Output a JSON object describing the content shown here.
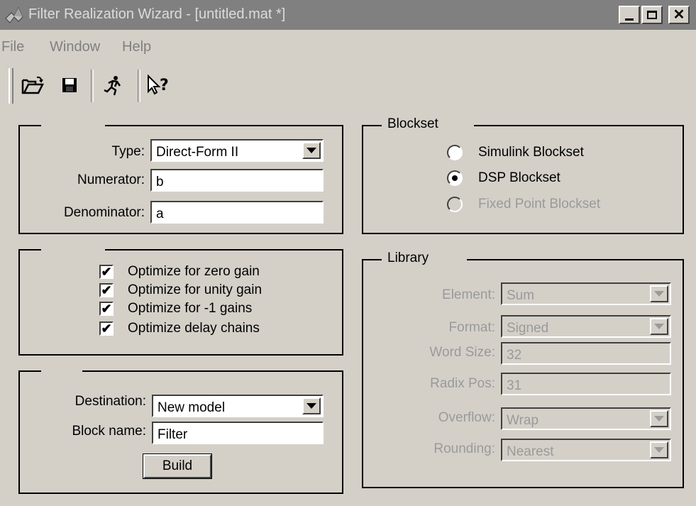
{
  "window": {
    "title": "Filter Realization Wizard - [untitled.mat *]",
    "min_label": "_",
    "max_label": "□",
    "close_label": "✕"
  },
  "menu": [
    "File",
    "Window",
    "Help"
  ],
  "toolbar": [
    "open-icon",
    "save-icon",
    "run-icon",
    "whats-this-icon"
  ],
  "structure": {
    "type_label": "Type:",
    "type_value": "Direct-Form II",
    "numerator_label": "Numerator:",
    "numerator_value": "b",
    "denominator_label": "Denominator:",
    "denominator_value": "a"
  },
  "optimization": {
    "items": [
      {
        "label": "Optimize for zero gain",
        "checked": true
      },
      {
        "label": "Optimize for unity gain",
        "checked": true
      },
      {
        "label": "Optimize for -1 gains",
        "checked": true
      },
      {
        "label": "Optimize delay chains",
        "checked": true
      }
    ]
  },
  "destination": {
    "destination_label": "Destination:",
    "destination_value": "New model",
    "block_name_label": "Block name:",
    "block_name_value": "Filter",
    "build_label": "Build"
  },
  "blockset": {
    "title": "Blockset",
    "options": [
      {
        "label": "Simulink Blockset",
        "selected": false,
        "enabled": true
      },
      {
        "label": "DSP Blockset",
        "selected": true,
        "enabled": true
      },
      {
        "label": "Fixed Point Blockset",
        "selected": false,
        "enabled": false
      }
    ]
  },
  "library": {
    "title": "Library",
    "element_label": "Element:",
    "element_value": "Sum",
    "format_label": "Format:",
    "format_value": "Signed",
    "word_size_label": "Word Size:",
    "word_size_value": "32",
    "radix_pos_label": "Radix Pos:",
    "radix_pos_value": "31",
    "overflow_label": "Overflow:",
    "overflow_value": "Wrap",
    "rounding_label": "Rounding:",
    "rounding_value": "Nearest"
  }
}
